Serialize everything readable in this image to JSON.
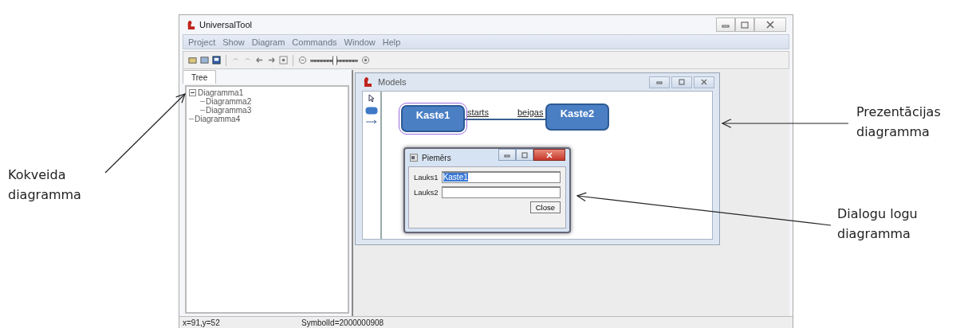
{
  "window": {
    "title": "UniversalTool"
  },
  "menu": [
    "Project",
    "Show",
    "Diagram",
    "Commands",
    "Window",
    "Help"
  ],
  "zoom_slider": {
    "level": 0.5
  },
  "tabs": [
    {
      "label": "Tree",
      "selected": true
    }
  ],
  "tree": [
    {
      "label": "Diagramma1",
      "expanded": true,
      "children": [
        {
          "label": "Diagramma2"
        },
        {
          "label": "Diagramma3"
        }
      ]
    },
    {
      "label": "Diagramma4"
    }
  ],
  "models_window": {
    "title": "Models",
    "nodes": [
      {
        "label": "Kaste1",
        "selected": true
      },
      {
        "label": "Kaste2",
        "selected": false
      }
    ],
    "edge": {
      "start_label": "starts",
      "end_label": "beigas"
    },
    "dialog": {
      "title": "Piemērs",
      "fields": [
        {
          "label": "Lauks1",
          "value": "Kaste1",
          "selected": true
        },
        {
          "label": "Lauks2"
        }
      ],
      "button": "Close"
    }
  },
  "status_bar": [
    "x=91,y=52",
    "SymbolId=2000000908"
  ],
  "annotations": [
    "Kokveida diagramma",
    "Prezentācijas diagramma",
    "Dialogu logu diagramma"
  ]
}
